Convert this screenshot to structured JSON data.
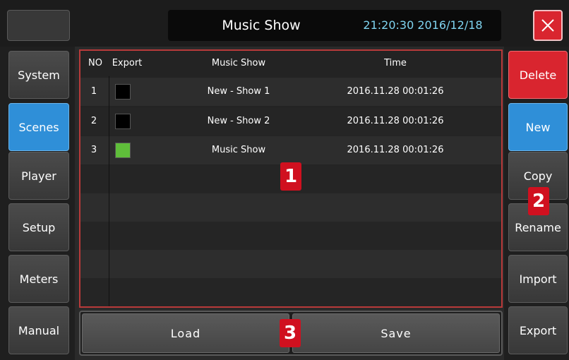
{
  "header": {
    "title": "Music Show",
    "clock": "21:20:30  2016/12/18"
  },
  "nav": {
    "items": [
      {
        "label": "System"
      },
      {
        "label": "Scenes"
      },
      {
        "label": "Player"
      },
      {
        "label": "Setup"
      },
      {
        "label": "Meters"
      },
      {
        "label": "Manual"
      }
    ],
    "active": "Scenes"
  },
  "actions": {
    "items": [
      {
        "label": "Delete"
      },
      {
        "label": "New"
      },
      {
        "label": "Copy"
      },
      {
        "label": "Rename"
      },
      {
        "label": "Import"
      },
      {
        "label": "Export"
      }
    ]
  },
  "table": {
    "columns": [
      "NO",
      "Export",
      "Music Show",
      "Time"
    ],
    "rows": [
      {
        "no": "1",
        "export_color": "#000000",
        "name": "New - Show 1",
        "time": "2016.11.28  00:01:26"
      },
      {
        "no": "2",
        "export_color": "#000000",
        "name": "New - Show 2",
        "time": "2016.11.28  00:01:26"
      },
      {
        "no": "3",
        "export_color": "#5fbe3a",
        "name": "Music Show",
        "time": "2016.11.28  00:01:26"
      }
    ]
  },
  "bottom": {
    "load_label": "Load",
    "save_label": "Save"
  },
  "callouts": [
    "1",
    "2",
    "3"
  ],
  "colors": {
    "accent_blue": "#2f8fd8",
    "danger_red": "#d9252f",
    "clock_cyan": "#7fd4f0",
    "callout_red": "#d0101f",
    "export_green": "#5fbe3a"
  }
}
